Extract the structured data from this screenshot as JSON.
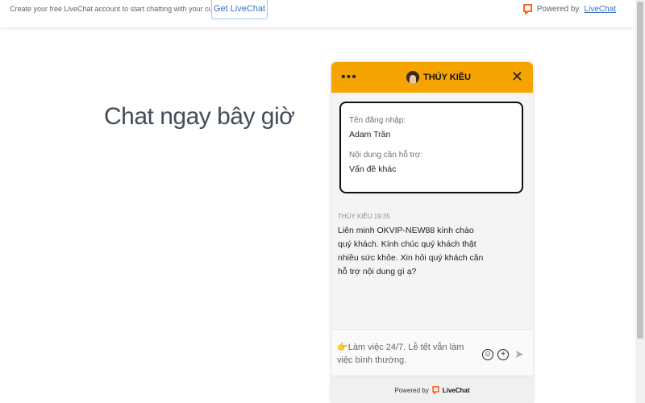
{
  "topbar": {
    "promo": "Create your free LiveChat account to start chatting with your customers",
    "get_button": "Get LiveChat",
    "powered_prefix": "Powered by",
    "powered_link": "LiveChat"
  },
  "main": {
    "headline": "Chat ngay bây giờ"
  },
  "widget": {
    "agent_name": "THÚY KIỀU",
    "form": {
      "username_label": "Tên đăng nhập:",
      "username_value": "Adam Trần",
      "support_label": "Nội dung cần hỗ trợ:",
      "support_value": "Vấn đề khác"
    },
    "message": {
      "meta": "THÚY KIỀU 19:35",
      "text": "Liên minh OKVIP-NEW88 kính chào quý khách. Kính chúc quý khách thật nhiều sức khỏe. Xin hỏi quý khách cần hỗ trợ nội dung gì ạ?"
    },
    "input": {
      "text": "👉Làm việc 24/7. Lễ tết vẫn làm việc bình thường."
    },
    "footer": {
      "prefix": "Powered by",
      "brand": "LiveChat"
    }
  },
  "colors": {
    "header": "#f6a500",
    "accent_blue": "#3a72c4",
    "livechat_orange": "#ff5100"
  }
}
